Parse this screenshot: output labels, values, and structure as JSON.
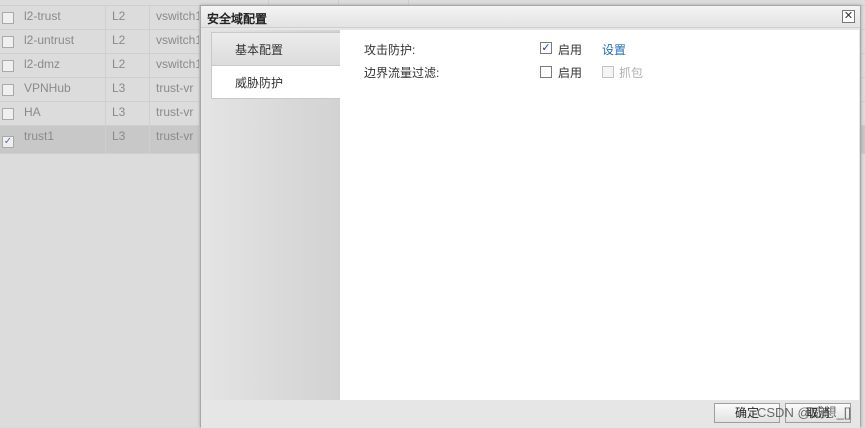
{
  "background_table": {
    "rows": [
      {
        "name": "l2-trust",
        "type": "L2",
        "router": "vswitch1",
        "checked": false
      },
      {
        "name": "l2-untrust",
        "type": "L2",
        "router": "vswitch1",
        "checked": false
      },
      {
        "name": "l2-dmz",
        "type": "L2",
        "router": "vswitch1",
        "checked": false
      },
      {
        "name": "VPNHub",
        "type": "L3",
        "router": "trust-vr",
        "checked": false
      },
      {
        "name": "HA",
        "type": "L3",
        "router": "trust-vr",
        "checked": false
      },
      {
        "name": "trust1",
        "type": "L3",
        "router": "trust-vr",
        "checked": true
      }
    ],
    "check_mark": "✓"
  },
  "dialog": {
    "title": "安全域配置",
    "close_glyph": "✕",
    "tabs": [
      {
        "label": "基本配置",
        "active": false
      },
      {
        "label": "威胁防护",
        "active": true
      }
    ],
    "form": {
      "attack_protection": {
        "label": "攻击防护:",
        "enable_label": "启用",
        "enabled": true,
        "link": "设置"
      },
      "boundary_filter": {
        "label": "边界流量过滤:",
        "enable_label": "启用",
        "enabled": false,
        "capture_label": "抓包",
        "capture_enabled": false
      }
    },
    "footer": {
      "ok_label": "确定",
      "cancel_label": "取消"
    }
  },
  "watermark": "CSDN @威想_[]",
  "colors": {
    "link": "#1f6fb5",
    "check": "#1c3f8a"
  }
}
